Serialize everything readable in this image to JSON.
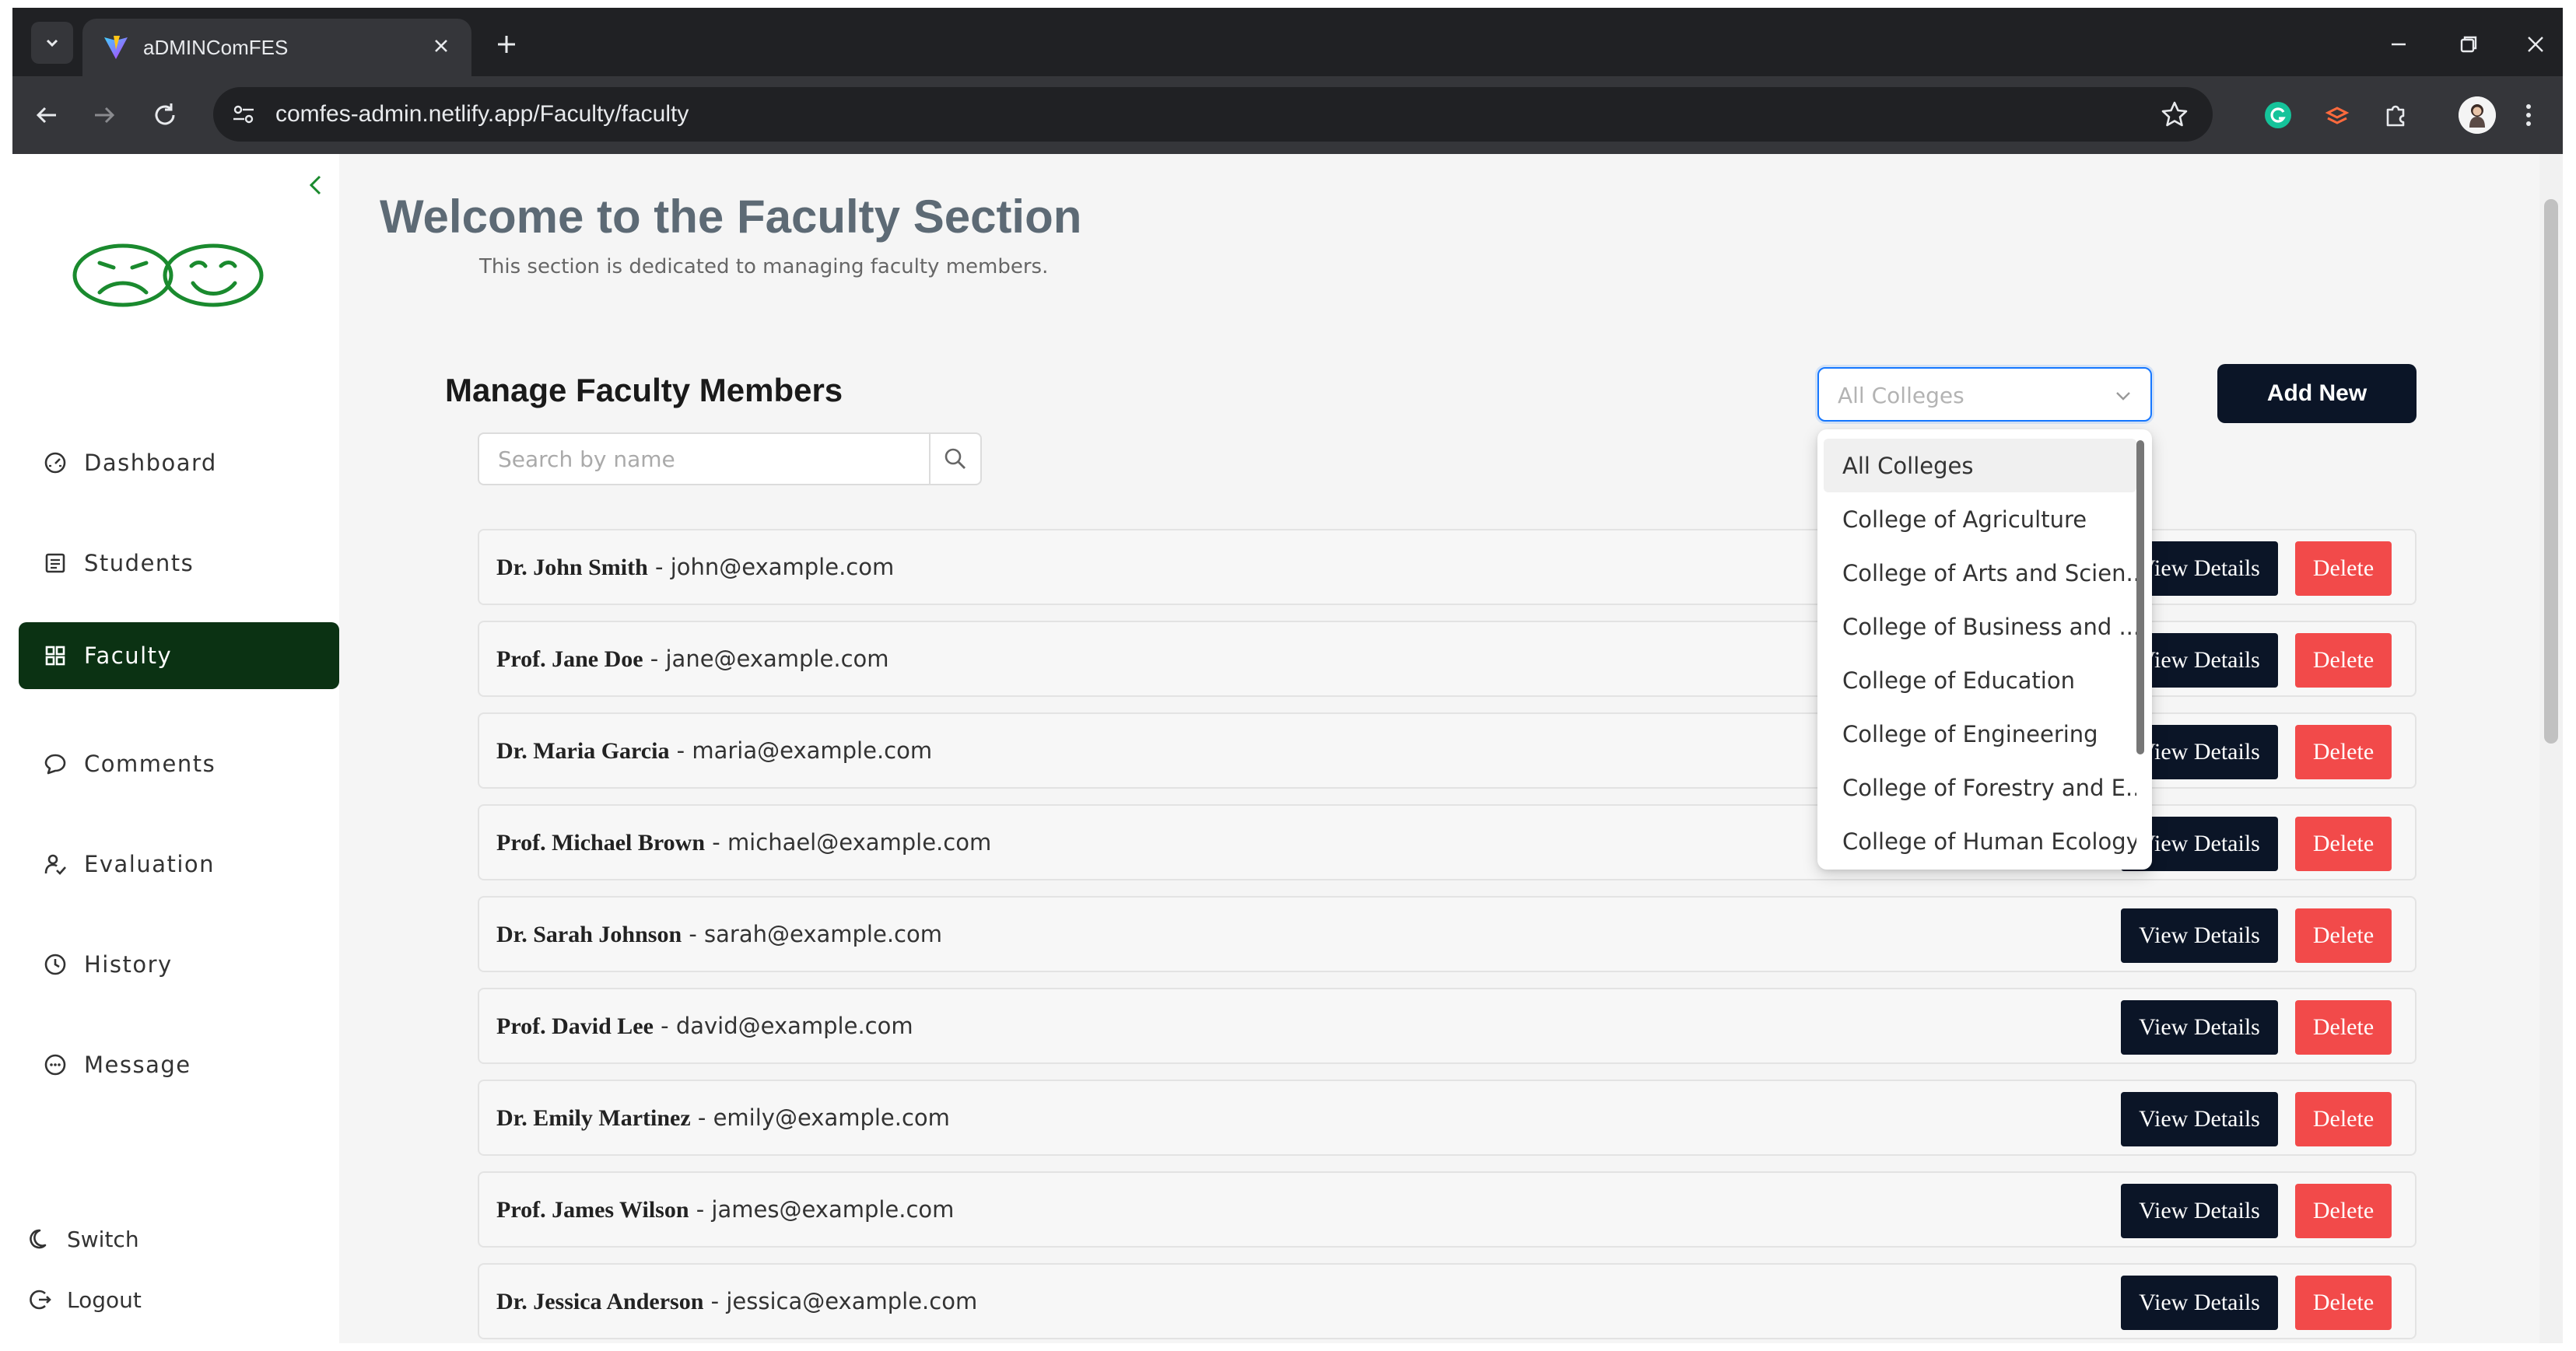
{
  "browser": {
    "tab_title": "aDMINComFES",
    "url": "comfes-admin.netlify.app/Faculty/faculty"
  },
  "sidebar": {
    "nav": [
      {
        "label": "Dashboard",
        "icon": "gauge-icon"
      },
      {
        "label": "Students",
        "icon": "list-icon"
      },
      {
        "label": "Faculty",
        "icon": "grid-icon",
        "active": true
      },
      {
        "label": "Comments",
        "icon": "chat-icon"
      },
      {
        "label": "Evaluation",
        "icon": "user-check-icon"
      },
      {
        "label": "History",
        "icon": "clock-icon"
      },
      {
        "label": "Message",
        "icon": "message-icon"
      }
    ],
    "switch_label": "Switch",
    "logout_label": "Logout"
  },
  "header": {
    "title": "Welcome to the Faculty Section",
    "subtitle": "This section is dedicated to managing faculty members."
  },
  "manage": {
    "title": "Manage Faculty Members",
    "search_placeholder": "Search by name",
    "college_select_value": "All Colleges",
    "add_new_label": "Add New"
  },
  "dropdown": {
    "options": [
      "All Colleges",
      "College of Agriculture",
      "College of Arts and Scien...",
      "College of Business and ...",
      "College of Education",
      "College of Engineering",
      "College of Forestry and E...",
      "College of Human Ecology"
    ]
  },
  "faculty": [
    {
      "name": "Dr. John Smith",
      "email": "john@example.com"
    },
    {
      "name": "Prof. Jane Doe",
      "email": "jane@example.com"
    },
    {
      "name": "Dr. Maria Garcia",
      "email": "maria@example.com"
    },
    {
      "name": "Prof. Michael Brown",
      "email": "michael@example.com"
    },
    {
      "name": "Dr. Sarah Johnson",
      "email": "sarah@example.com"
    },
    {
      "name": "Prof. David Lee",
      "email": "david@example.com"
    },
    {
      "name": "Dr. Emily Martinez",
      "email": "emily@example.com"
    },
    {
      "name": "Prof. James Wilson",
      "email": "james@example.com"
    },
    {
      "name": "Dr. Jessica Anderson",
      "email": "jessica@example.com"
    }
  ],
  "row_actions": {
    "view_label": "View Details",
    "delete_label": "Delete"
  },
  "colors": {
    "active_nav": "#0b3213",
    "primary_button": "#0b1527",
    "delete_button": "#f24a4a",
    "logo": "#1a8a2e"
  }
}
